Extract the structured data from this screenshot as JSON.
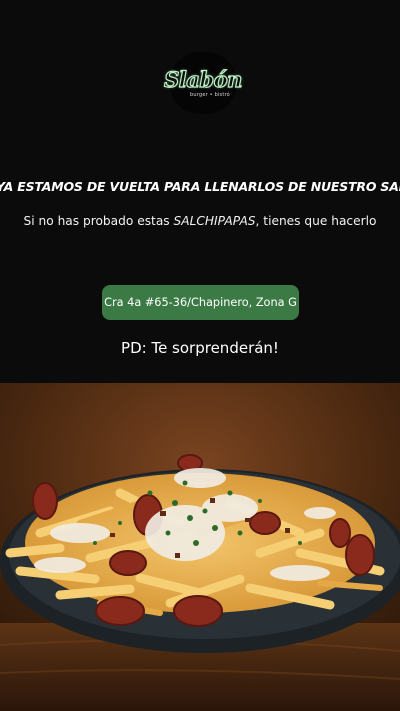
{
  "logo": {
    "word": "Slabón",
    "tagline": "burger • bistró"
  },
  "headline": "YA ESTAMOS DE VUELTA PARA LLENARLOS DE NUESTRO SABOR",
  "subline": {
    "before": "Si no has probado estas ",
    "emphasis": "SALCHIPAPAS",
    "after": ", tienes que hacerlo"
  },
  "address_button": {
    "label": "Cra 4a #65-36/Chapinero, Zona G"
  },
  "ps": "PD: Te sorprenderán!",
  "photo": {
    "subject": "salchipapas-plate"
  },
  "colors": {
    "accent_green": "#3c7a45",
    "logo_glow": "#b9f2c4",
    "background": "#0b0b0b"
  }
}
